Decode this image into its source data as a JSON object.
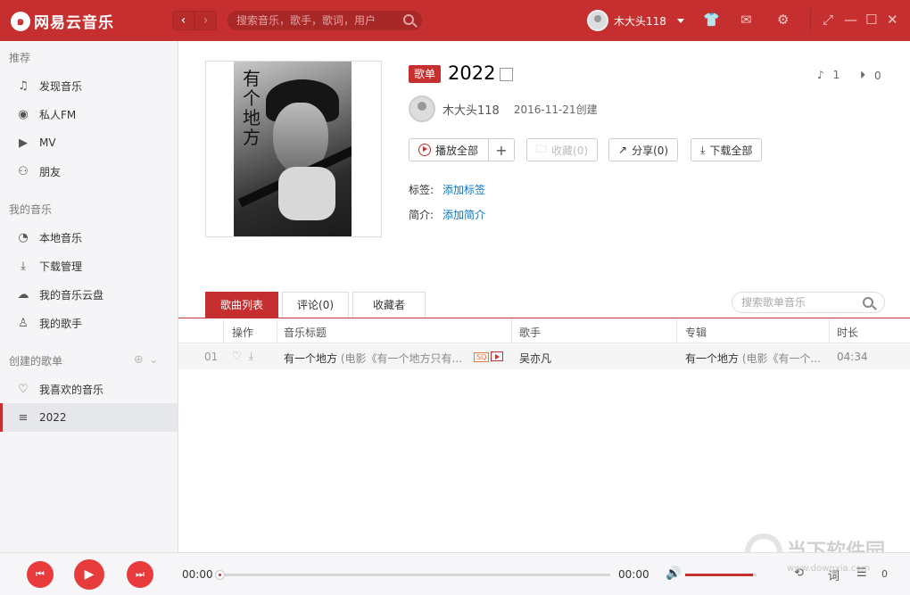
{
  "topbar": {
    "logo_mark": "๑",
    "logo_text": "网易云音乐",
    "back_label": "‹",
    "forward_label": "›",
    "search_placeholder": "搜索音乐，歌手，歌词，用户",
    "username": "木大头118",
    "icons": [
      "skin-icon",
      "mail-icon",
      "settings-icon",
      "mini-mode-icon",
      "minimize-icon",
      "maximize-icon",
      "close-icon"
    ]
  },
  "sidebar": {
    "recommend_title": "推荐",
    "recommend_items": [
      {
        "label": "发现音乐",
        "icon": "♫"
      },
      {
        "label": "私人FM",
        "icon": "◉"
      },
      {
        "label": "MV",
        "icon": "▶"
      },
      {
        "label": "朋友",
        "icon": "⚇"
      }
    ],
    "my_music_title": "我的音乐",
    "my_music_items": [
      {
        "label": "本地音乐",
        "icon": "◔"
      },
      {
        "label": "下载管理",
        "icon": "⤓"
      },
      {
        "label": "我的音乐云盘",
        "icon": "☁"
      },
      {
        "label": "我的歌手",
        "icon": "♙"
      }
    ],
    "created_title": "创建的歌单",
    "created_items": [
      {
        "label": "我喜欢的音乐",
        "icon": "♡"
      },
      {
        "label": "2022",
        "icon": "≡"
      }
    ]
  },
  "playlist": {
    "cover_title": "有个地方",
    "badge": "歌单",
    "title": "2022",
    "song_count": "1",
    "play_count": "0",
    "creator": "木大头118",
    "created_date": "2016-11-21创建",
    "play_all": "播放全部",
    "add": "+",
    "collect": "收藏(0)",
    "share": "分享(0)",
    "download_all": "下载全部",
    "tags_label": "标签:",
    "tags_link": "添加标签",
    "intro_label": "简介:",
    "intro_link": "添加简介"
  },
  "tabs": [
    "歌曲列表",
    "评论(0)",
    "收藏者"
  ],
  "list_search_placeholder": "搜索歌单音乐",
  "table": {
    "headers": [
      "操作",
      "音乐标题",
      "歌手",
      "专辑",
      "时长"
    ],
    "rows": [
      {
        "num": "01",
        "title": "有一个地方",
        "title_note": "(电影《有一个地方只有...",
        "quality": "SQ",
        "artist": "吴亦凡",
        "album": "有一个地方",
        "album_note": "(电影《有一个...",
        "duration": "04:34"
      }
    ]
  },
  "player": {
    "current_time": "00:00",
    "total_time": "00:00",
    "progress": 0,
    "volume": 0.95,
    "lyrics_label": "词",
    "queue_count": "0"
  },
  "watermark": {
    "text": "当下软件园",
    "url": "www.downxia.com"
  }
}
